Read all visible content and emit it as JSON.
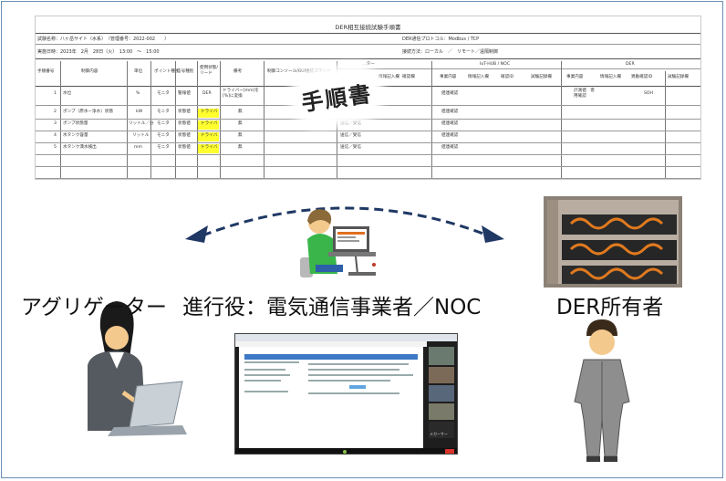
{
  "document": {
    "title": "DER相互接続試験手順書",
    "meta_rows": [
      "試験名称：八ヶ岳サイト（水系）　（管理番号：2022-002　　）",
      "実施日時：2023年　2月　28日（火）　13:00　～　15:00"
    ],
    "meta_right": [
      "DER通信プロトコル：Modbus / TCP",
      "接続方法：ローカル　／　リモート／遠隔制御"
    ],
    "headers": [
      "手順番号",
      "制御内容",
      "単位",
      "ポイント種別",
      "信号種別",
      "使用状態/リード",
      "備考",
      "制御コンソール/GUI送信コマンド",
      "…ター",
      "IoT-HUB / NOC",
      "DER"
    ],
    "subheaders": [
      "事業内容",
      "情報記入欄",
      "確認欄",
      "事業内容",
      "情報記入欄",
      "確認ID",
      "試験記録欄",
      "事業内容",
      "情報記入欄",
      "異動確認ID",
      "試験記録欄"
    ],
    "rows": [
      {
        "no": "1",
        "content": "水位",
        "unit": "%",
        "point": "モニタ",
        "signal": "警報値",
        "status": "DER",
        "note": "ドライバー[mm]を[%]に変換",
        "r1": "",
        "r2": "値連確認",
        "r3": "計測値　客用確認",
        "r4": "SOH"
      },
      {
        "no": "2",
        "content": "ポンプ（原水ー浄水）状態",
        "unit": "kW",
        "point": "モニタ",
        "signal": "状態値",
        "status": "ドライバ",
        "note": "無",
        "r1": "",
        "r2": "値連確認",
        "r3": "",
        "r4": ""
      },
      {
        "no": "3",
        "content": "ポンプ状態量",
        "unit": "リットル／分",
        "point": "モニタ",
        "signal": "状態値",
        "status": "ドライバ",
        "note": "無",
        "r1": "送信／受信",
        "r2": "値連確認",
        "r3": "",
        "r4": ""
      },
      {
        "no": "4",
        "content": "水タンク容量",
        "unit": "リットル",
        "point": "モニタ",
        "signal": "状態値",
        "status": "ドライバ",
        "note": "無",
        "r1": "送信／受信",
        "r2": "値連確認",
        "r3": "",
        "r4": ""
      },
      {
        "no": "5",
        "content": "水タンク満水検出",
        "unit": "mm",
        "point": "モニタ",
        "signal": "状態値",
        "status": "ドライバ",
        "note": "無",
        "r1": "送信／受信",
        "r2": "値連確認",
        "r3": "",
        "r4": ""
      }
    ]
  },
  "badge": "手順書",
  "labels": {
    "aggregator": "アグリゲーター",
    "facilitator": "進行役：電気通信事業者／NOC",
    "der_owner": "DER所有者"
  },
  "video_call": {
    "participant": "メガーサー"
  },
  "colors": {
    "arrow": "#1f3864",
    "frame": "#6b8fb5",
    "highlight": "#ffff2e"
  }
}
